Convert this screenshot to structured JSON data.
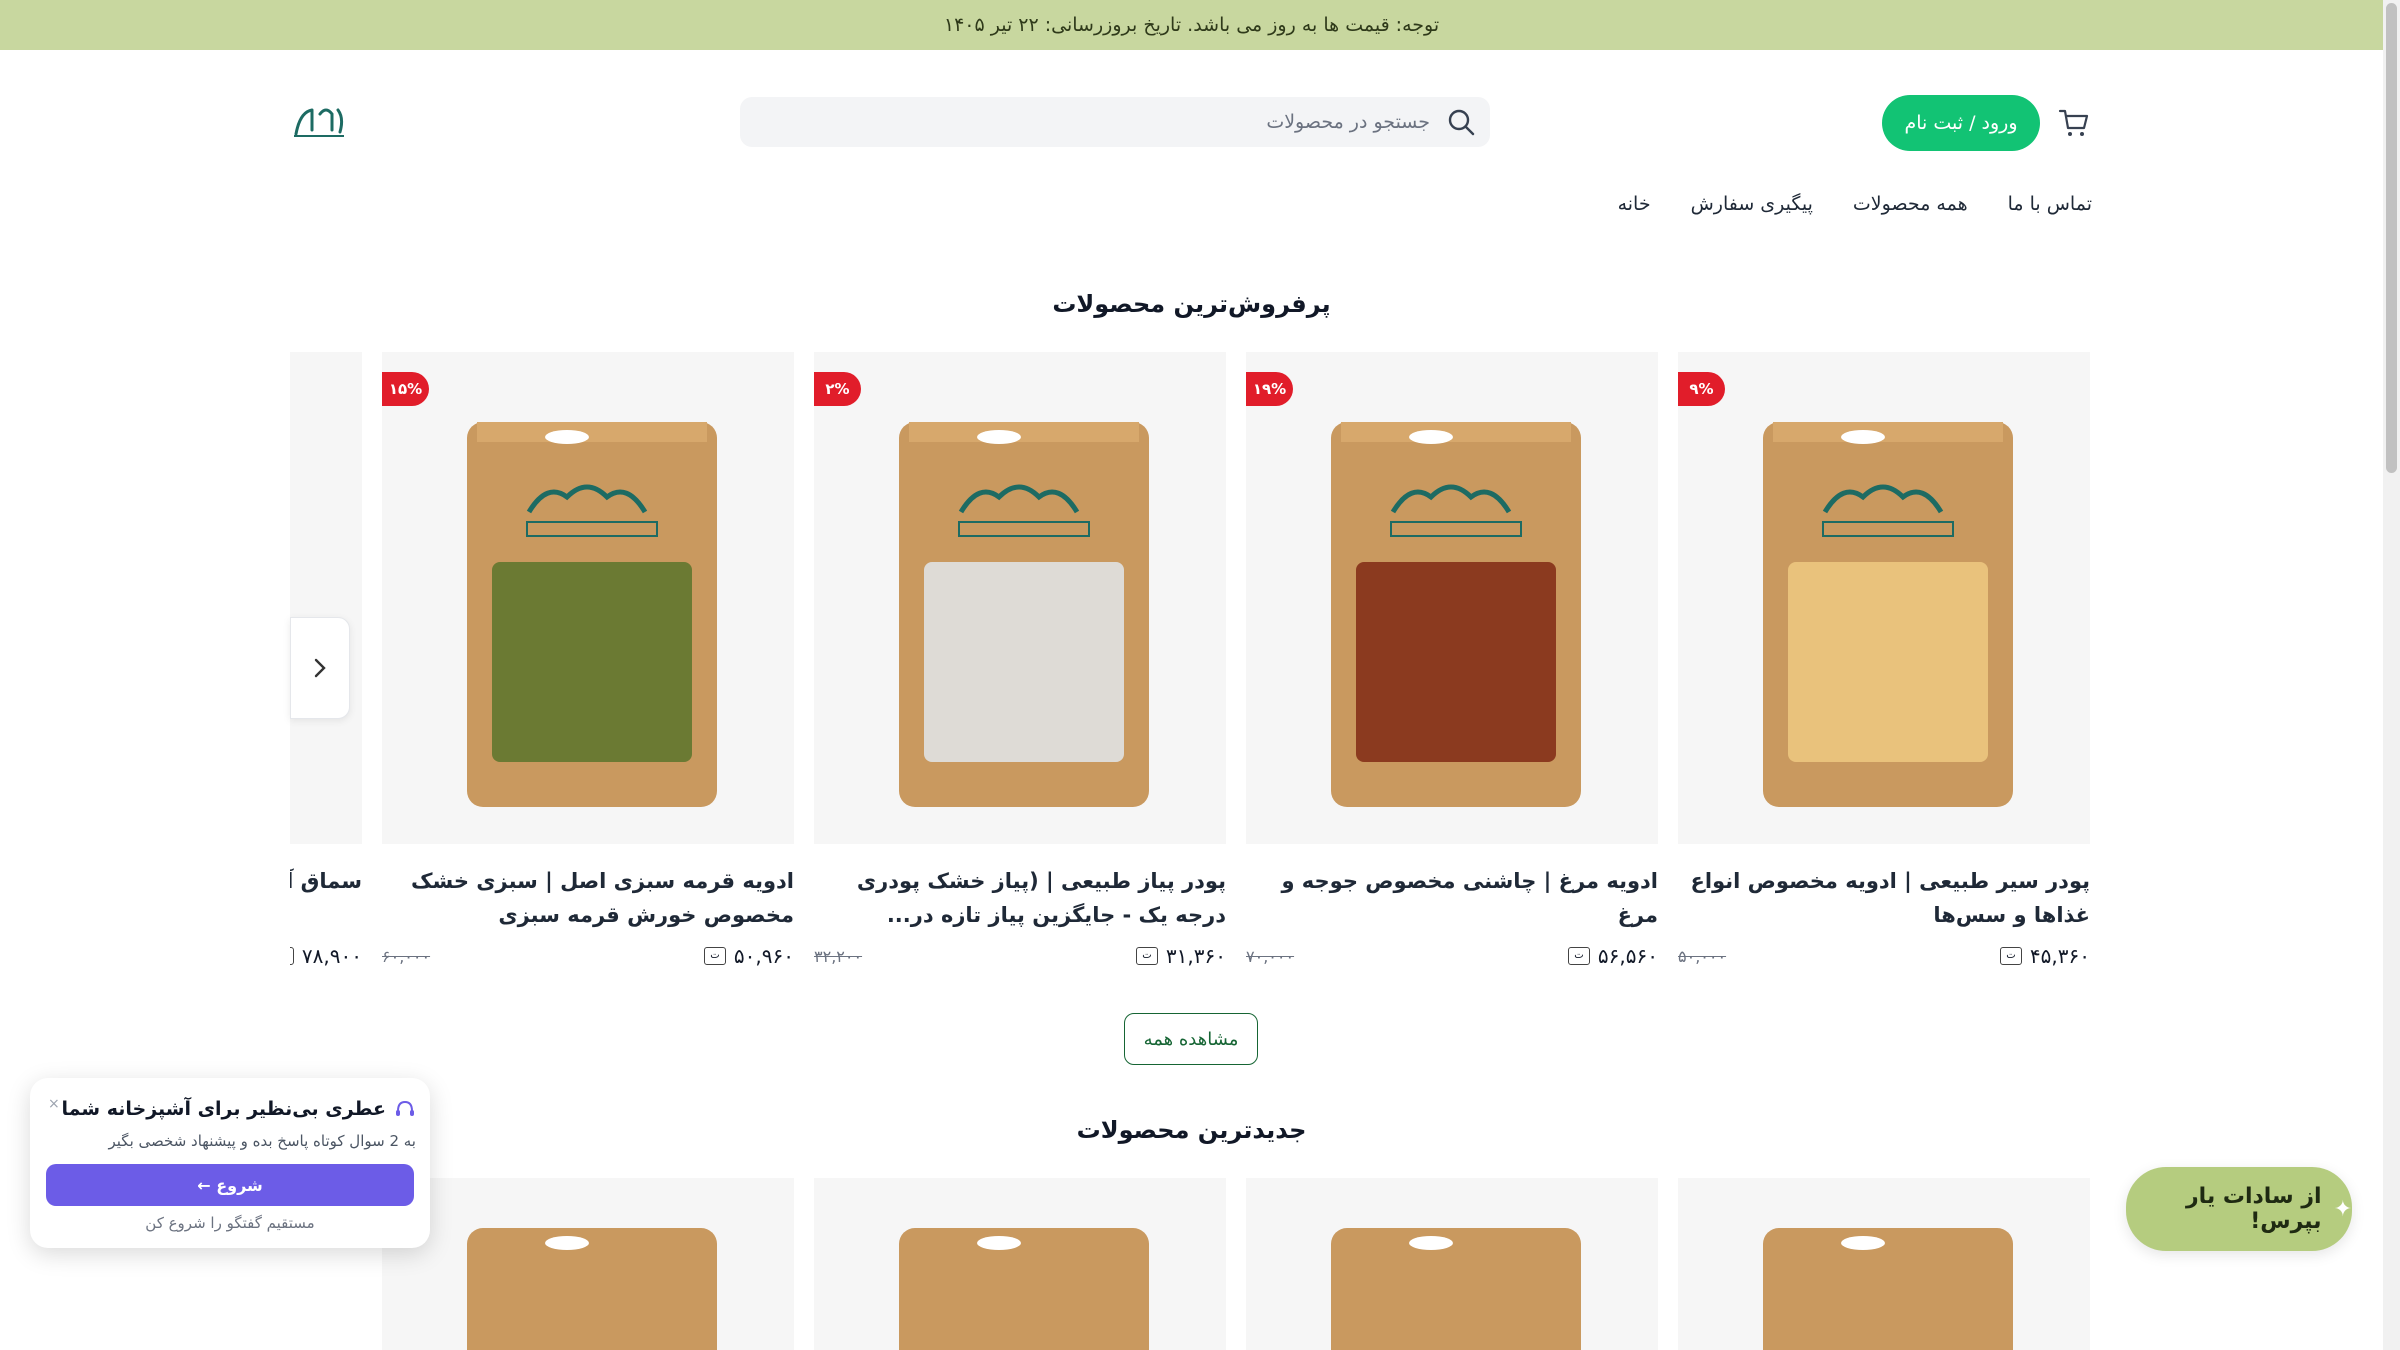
{
  "announcement": "توجه: قیمت ها به روز می باشد. تاریخ بروزرسانی: ۲۲ تیر ۱۴۰۵",
  "header": {
    "search_placeholder": "جستجو در محصولات",
    "login_label": "ورود / ثبت نام"
  },
  "nav": {
    "items": [
      "خانه",
      "پیگیری سفارش",
      "همه محصولات",
      "تماس با ما"
    ]
  },
  "bestsellers": {
    "title": "پرفروش‌ترین محصولات",
    "view_all": "مشاهده همه",
    "products": [
      {
        "title": "پودر سیر طبیعی | ادویه مخصوص انواع غذاها و سس‌ها",
        "price": "۴۵,۳۶۰",
        "old_price": "۵۰,۰۰۰",
        "discount": "۹%",
        "fill_color": "#e9c27c"
      },
      {
        "title": "ادویه مرغ | چاشنی مخصوص جوجه و مرغ",
        "price": "۵۶,۵۶۰",
        "old_price": "۷۰,۰۰۰",
        "discount": "۱۹%",
        "fill_color": "#8b3a1f"
      },
      {
        "title": "پودر پیاز طبیعی | (پیاز خشک پودری درجه یک - جایگزین پیاز تازه در...",
        "price": "۳۱,۳۶۰",
        "old_price": "۳۲,۲۰۰",
        "discount": "۲%",
        "fill_color": "#dedbd6"
      },
      {
        "title": "ادویه قرمه سبزی اصل | سبزی خشک مخصوص خورش قرمه سبزی",
        "price": "۵۰,۹۶۰",
        "old_price": "۶۰,۰۰۰",
        "discount": "۱۵%",
        "fill_color": "#6b7a33"
      },
      {
        "title": "سماق آسیاب شده (پودر سماق)",
        "price": "۷۸,۹۰۰",
        "old_price": "",
        "discount": "",
        "fill_color": "#b03a3a"
      }
    ]
  },
  "newest": {
    "title": "جدیدترین محصولات"
  },
  "chat": {
    "title": "عطری بی‌نظیر برای آشپزخانه شما",
    "subtitle": "به 2 سوال کوتاه پاسخ بده و پیشنهاد شخصی بگیر",
    "start_label": "شروع ←",
    "direct_label": "مستقیم گفتگو را شروع کن",
    "close": "×",
    "ask_label": "از سادات یار بپرس!"
  },
  "colors": {
    "announcement_bg": "#c8d79f",
    "login_bg": "#12c374",
    "badge": "#e11d2a",
    "chat_button": "#6c5ce7",
    "ask_bg": "#b5cc7f",
    "brand_teal": "#1d6b63"
  }
}
